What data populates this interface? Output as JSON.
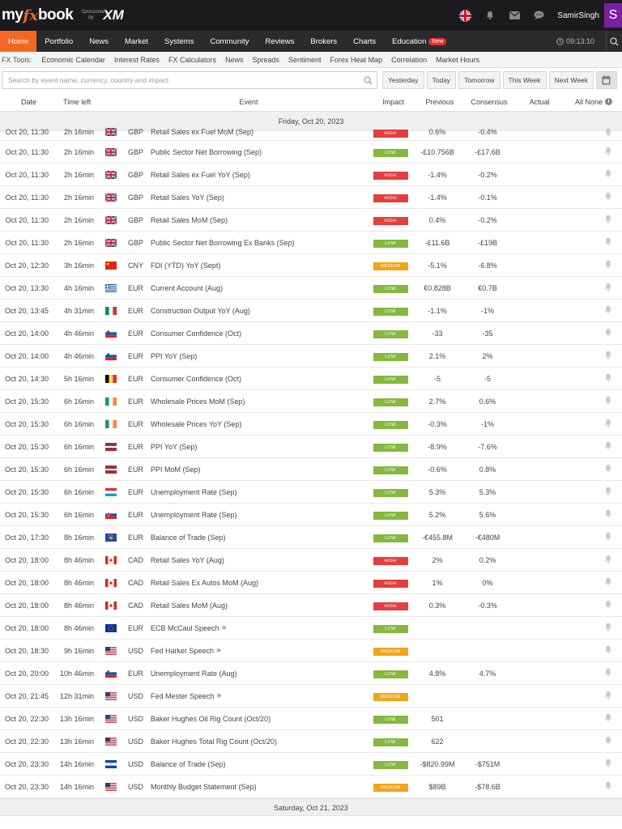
{
  "header": {
    "logo_prefix": "my",
    "logo_fx": "fx",
    "logo_suffix": "book",
    "sponsor_label": "Sponsored by",
    "sponsor_brand": "XM",
    "username": "SamirSingh",
    "avatar_letter": "S",
    "icons": [
      "uk-flag-icon",
      "bell-icon",
      "mail-icon",
      "chat-icon"
    ]
  },
  "nav": {
    "items": [
      "Home",
      "Portfolio",
      "News",
      "Market",
      "Systems",
      "Community",
      "Reviews",
      "Brokers",
      "Charts",
      "Education"
    ],
    "active": "Home",
    "education_badge": "New",
    "clock": "09:13:10"
  },
  "tools": {
    "label": "FX Tools:",
    "items": [
      "Economic Calendar",
      "Interest Rates",
      "FX Calculators",
      "News",
      "Spreads",
      "Sentiment",
      "Forex Heat Map",
      "Correlation",
      "Market Hours"
    ]
  },
  "filters": {
    "search_placeholder": "Search by event name, currency, country and impact",
    "buttons": [
      "Yesterday",
      "Today",
      "Tomorrow",
      "This Week",
      "Next Week"
    ]
  },
  "table": {
    "headers": {
      "date": "Date",
      "time_left": "Time left",
      "event": "Event",
      "impact": "Impact",
      "previous": "Previous",
      "consensus": "Consensus",
      "actual": "Actual",
      "all_none": "All None"
    },
    "day1": "Friday, Oct 20, 2023",
    "day2": "Saturday, Oct 21, 2023",
    "rows": [
      {
        "date": "Oct 20, 11:30",
        "left": "2h 16min",
        "flag": "gb",
        "cur": "GBP",
        "event": "Retail Sales ex Fuel MoM (Sep)",
        "impact": "HIGH",
        "prev": "0.6%",
        "cons": "-0.4%",
        "speech": false
      },
      {
        "date": "Oct 20, 11:30",
        "left": "2h 16min",
        "flag": "gb",
        "cur": "GBP",
        "event": "Public Sector Net Borrowing (Sep)",
        "impact": "LOW",
        "prev": "-£10.756B",
        "cons": "-£17.6B",
        "speech": false
      },
      {
        "date": "Oct 20, 11:30",
        "left": "2h 16min",
        "flag": "gb",
        "cur": "GBP",
        "event": "Retail Sales ex Fuel YoY (Sep)",
        "impact": "HIGH",
        "prev": "-1.4%",
        "cons": "-0.2%",
        "speech": false
      },
      {
        "date": "Oct 20, 11:30",
        "left": "2h 16min",
        "flag": "gb",
        "cur": "GBP",
        "event": "Retail Sales YoY (Sep)",
        "impact": "HIGH",
        "prev": "-1.4%",
        "cons": "-0.1%",
        "speech": false
      },
      {
        "date": "Oct 20, 11:30",
        "left": "2h 16min",
        "flag": "gb",
        "cur": "GBP",
        "event": "Retail Sales MoM (Sep)",
        "impact": "HIGH",
        "prev": "0.4%",
        "cons": "-0.2%",
        "speech": false
      },
      {
        "date": "Oct 20, 11:30",
        "left": "2h 16min",
        "flag": "gb",
        "cur": "GBP",
        "event": "Public Sector Net Borrowing Ex Banks (Sep)",
        "impact": "LOW",
        "prev": "-£11.6B",
        "cons": "-£19B",
        "speech": false
      },
      {
        "date": "Oct 20, 12:30",
        "left": "3h 16min",
        "flag": "cn",
        "cur": "CNY",
        "event": "FDI (YTD) YoY (Sept)",
        "impact": "MEDIUM",
        "prev": "-5.1%",
        "cons": "-6.8%",
        "speech": false
      },
      {
        "date": "Oct 20, 13:30",
        "left": "4h 16min",
        "flag": "gr",
        "cur": "EUR",
        "event": "Current Account (Aug)",
        "impact": "LOW",
        "prev": "€0.828B",
        "cons": "€0.7B",
        "speech": false
      },
      {
        "date": "Oct 20, 13:45",
        "left": "4h 31min",
        "flag": "it",
        "cur": "EUR",
        "event": "Construction Output YoY (Aug)",
        "impact": "LOW",
        "prev": "-1.1%",
        "cons": "-1%",
        "speech": false
      },
      {
        "date": "Oct 20, 14:00",
        "left": "4h 46min",
        "flag": "si",
        "cur": "EUR",
        "event": "Consumer Confidence (Oct)",
        "impact": "LOW",
        "prev": "-33",
        "cons": "-35",
        "speech": false
      },
      {
        "date": "Oct 20, 14:00",
        "left": "4h 46min",
        "flag": "si",
        "cur": "EUR",
        "event": "PPI YoY (Sep)",
        "impact": "LOW",
        "prev": "2.1%",
        "cons": "2%",
        "speech": false
      },
      {
        "date": "Oct 20, 14:30",
        "left": "5h 16min",
        "flag": "be",
        "cur": "EUR",
        "event": "Consumer Confidence (Oct)",
        "impact": "LOW",
        "prev": "-5",
        "cons": "-5",
        "speech": false
      },
      {
        "date": "Oct 20, 15:30",
        "left": "6h 16min",
        "flag": "ie",
        "cur": "EUR",
        "event": "Wholesale Prices MoM (Sep)",
        "impact": "LOW",
        "prev": "2.7%",
        "cons": "0.6%",
        "speech": false
      },
      {
        "date": "Oct 20, 15:30",
        "left": "6h 16min",
        "flag": "ie",
        "cur": "EUR",
        "event": "Wholesale Prices YoY (Sep)",
        "impact": "LOW",
        "prev": "-0.3%",
        "cons": "-1%",
        "speech": false
      },
      {
        "date": "Oct 20, 15:30",
        "left": "6h 16min",
        "flag": "lv",
        "cur": "EUR",
        "event": "PPI YoY (Sep)",
        "impact": "LOW",
        "prev": "-8.9%",
        "cons": "-7.6%",
        "speech": false
      },
      {
        "date": "Oct 20, 15:30",
        "left": "6h 16min",
        "flag": "lv",
        "cur": "EUR",
        "event": "PPI MoM (Sep)",
        "impact": "LOW",
        "prev": "-0.6%",
        "cons": "0.8%",
        "speech": false
      },
      {
        "date": "Oct 20, 15:30",
        "left": "6h 16min",
        "flag": "lu",
        "cur": "EUR",
        "event": "Unemployment Rate (Sep)",
        "impact": "LOW",
        "prev": "5.3%",
        "cons": "5.3%",
        "speech": false
      },
      {
        "date": "Oct 20, 15:30",
        "left": "6h 16min",
        "flag": "sk",
        "cur": "EUR",
        "event": "Unemployment Rate (Sep)",
        "impact": "LOW",
        "prev": "5.2%",
        "cons": "5.6%",
        "speech": false
      },
      {
        "date": "Oct 20, 17:30",
        "left": "8h 16min",
        "flag": "xk",
        "cur": "EUR",
        "event": "Balance of Trade (Sep)",
        "impact": "LOW",
        "prev": "-€455.8M",
        "cons": "-€480M",
        "speech": false
      },
      {
        "date": "Oct 20, 18:00",
        "left": "8h 46min",
        "flag": "ca",
        "cur": "CAD",
        "event": "Retail Sales YoY (Aug)",
        "impact": "HIGH",
        "prev": "2%",
        "cons": "0.2%",
        "speech": false
      },
      {
        "date": "Oct 20, 18:00",
        "left": "8h 46min",
        "flag": "ca",
        "cur": "CAD",
        "event": "Retail Sales Ex Autos MoM (Aug)",
        "impact": "HIGH",
        "prev": "1%",
        "cons": "0%",
        "speech": false
      },
      {
        "date": "Oct 20, 18:00",
        "left": "8h 46min",
        "flag": "ca",
        "cur": "CAD",
        "event": "Retail Sales MoM (Aug)",
        "impact": "HIGH",
        "prev": "0.3%",
        "cons": "-0.3%",
        "speech": false
      },
      {
        "date": "Oct 20, 18:00",
        "left": "8h 46min",
        "flag": "eu",
        "cur": "EUR",
        "event": "ECB McCaul Speech",
        "impact": "LOW",
        "prev": "",
        "cons": "",
        "speech": true
      },
      {
        "date": "Oct 20, 18:30",
        "left": "9h 16min",
        "flag": "us",
        "cur": "USD",
        "event": "Fed Harker Speech",
        "impact": "MEDIUM",
        "prev": "",
        "cons": "",
        "speech": true
      },
      {
        "date": "Oct 20, 20:00",
        "left": "10h 46min",
        "flag": "si",
        "cur": "EUR",
        "event": "Unemployment Rate (Aug)",
        "impact": "LOW",
        "prev": "4.8%",
        "cons": "4.7%",
        "speech": false
      },
      {
        "date": "Oct 20, 21:45",
        "left": "12h 31min",
        "flag": "us",
        "cur": "USD",
        "event": "Fed Mester Speech",
        "impact": "MEDIUM",
        "prev": "",
        "cons": "",
        "speech": true
      },
      {
        "date": "Oct 20, 22:30",
        "left": "13h 16min",
        "flag": "us",
        "cur": "USD",
        "event": "Baker Hughes Oil Rig Count (Oct/20)",
        "impact": "LOW",
        "prev": "501",
        "cons": "",
        "speech": false
      },
      {
        "date": "Oct 20, 22:30",
        "left": "13h 16min",
        "flag": "us",
        "cur": "USD",
        "event": "Baker Hughes Total Rig Count (Oct/20)",
        "impact": "LOW",
        "prev": "622",
        "cons": "",
        "speech": false
      },
      {
        "date": "Oct 20, 23:30",
        "left": "14h 16min",
        "flag": "sv",
        "cur": "USD",
        "event": "Balance of Trade (Sep)",
        "impact": "LOW",
        "prev": "-$820.99M",
        "cons": "-$751M",
        "speech": false
      },
      {
        "date": "Oct 20, 23:30",
        "left": "14h 16min",
        "flag": "us",
        "cur": "USD",
        "event": "Monthly Budget Statement (Sep)",
        "impact": "MEDIUM",
        "prev": "$89B",
        "cons": "-$78.6B",
        "speech": false
      }
    ]
  },
  "colors": {
    "accent": "#f26722",
    "high": "#e53e3e",
    "low": "#85b83f",
    "medium": "#f0a51f",
    "header_bg": "#1b1b1e"
  }
}
